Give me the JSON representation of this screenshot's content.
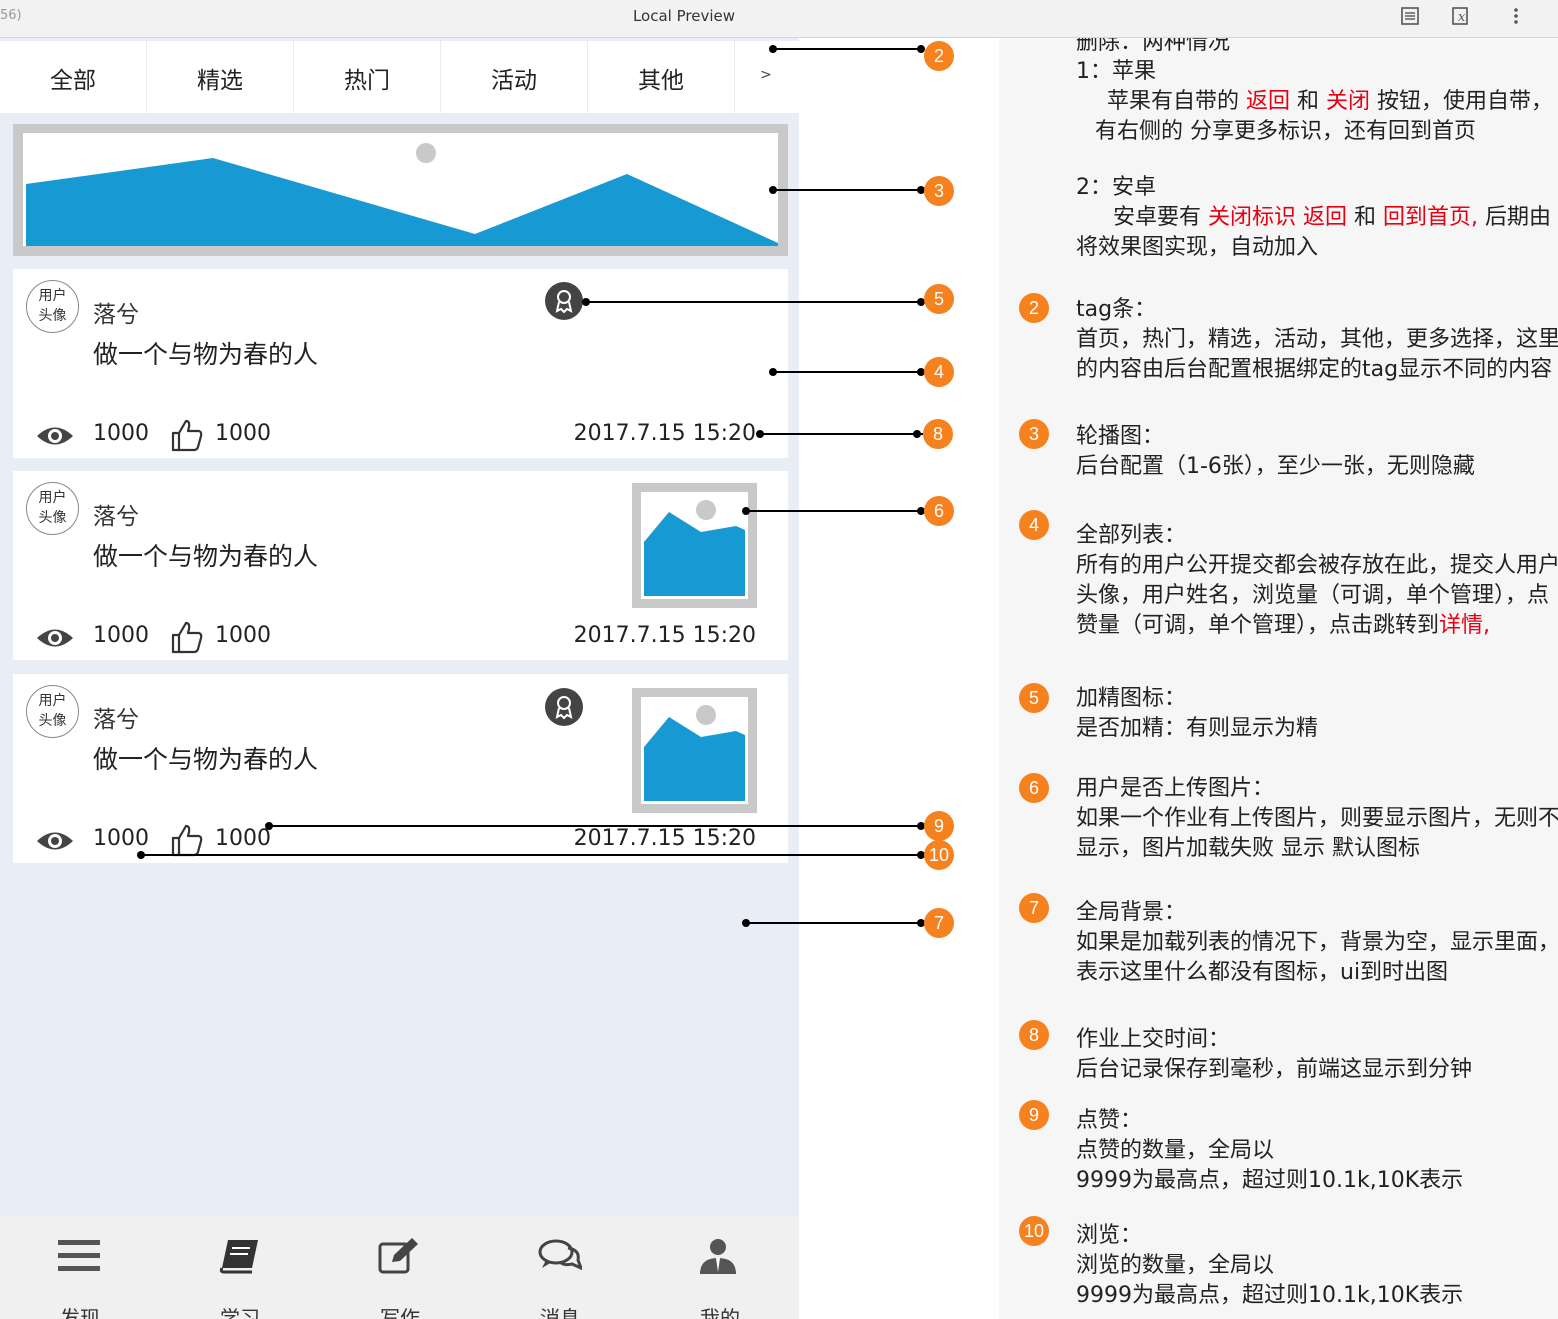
{
  "window": {
    "left_fragment": "56)",
    "title": "Local Preview",
    "icons": [
      "document-icon",
      "formula-icon",
      "more-vertical-icon"
    ]
  },
  "tabs": {
    "items": [
      "全部",
      "精选",
      "热门",
      "活动",
      "其他"
    ],
    "more": ">"
  },
  "cards": [
    {
      "avatar_line1": "用户",
      "avatar_line2": "头像",
      "name": "落兮",
      "text": "做一个与物为春的人",
      "views": "1000",
      "likes": "1000",
      "time": "2017.7.15 15:20",
      "badge": true,
      "image": false
    },
    {
      "avatar_line1": "用户",
      "avatar_line2": "头像",
      "name": "落兮",
      "text": "做一个与物为春的人",
      "views": "1000",
      "likes": "1000",
      "time": "2017.7.15 15:20",
      "badge": false,
      "image": true
    },
    {
      "avatar_line1": "用户",
      "avatar_line2": "头像",
      "name": "落兮",
      "text": "做一个与物为春的人",
      "views": "1000",
      "likes": "1000",
      "time": "2017.7.15 15:20",
      "badge": true,
      "image": true
    }
  ],
  "bottom_nav": [
    "发现",
    "学习",
    "写作",
    "消息",
    "我的"
  ],
  "markers": {
    "m2": "2",
    "m3": "3",
    "m5": "5",
    "m4": "4",
    "m8": "8",
    "m6": "6",
    "m9": "9",
    "m10": "10",
    "m7": "7"
  },
  "notes": {
    "top_cut": "删除：两种情况",
    "apple_title": "1：苹果",
    "apple_p1": "苹果有自带的 ",
    "apple_r1": "返回",
    "apple_p2": " 和 ",
    "apple_r2": "关闭",
    "apple_p3": " 按钮，使用自带，",
    "apple_line2": "有右侧的 分享更多标识，还有回到首页",
    "android_title": "2：安卓",
    "android_p1": "安卓要有 ",
    "android_r1": "关闭标识 返回",
    "android_p2": " 和 ",
    "android_r2": "回到首页,",
    "android_p3": " 后期由",
    "android_line2": "将效果图实现，自动加入",
    "items": [
      {
        "num": "2",
        "title": "tag条：",
        "lines": [
          "首页，热门，精选，活动，其他，更多选择，这里",
          "的内容由后台配置根据绑定的tag显示不同的内容"
        ]
      },
      {
        "num": "3",
        "title": "轮播图：",
        "lines": [
          "后台配置（1-6张），至少一张，无则隐藏"
        ]
      },
      {
        "num": "4",
        "title": "全部列表：",
        "lines": [
          "所有的用户公开提交都会被存放在此，提交人用户",
          "头像，用户姓名，浏览量（可调，单个管理），点"
        ],
        "line3a": "赞量（可调，单个管理），点击跳转到",
        "line3b": "详情,"
      },
      {
        "num": "5",
        "title": "加精图标：",
        "lines": [
          "是否加精：有则显示为精"
        ]
      },
      {
        "num": "6",
        "title": "用户是否上传图片：",
        "lines": [
          "如果一个作业有上传图片，则要显示图片，无则不",
          "显示，图片加载失败 显示 默认图标"
        ]
      },
      {
        "num": "7",
        "title": "全局背景：",
        "lines": [
          "如果是加载列表的情况下，背景为空，显示里面，",
          "表示这里什么都没有图标，ui到时出图"
        ]
      },
      {
        "num": "8",
        "title": "作业上交时间：",
        "lines": [
          "后台记录保存到毫秒，前端这显示到分钟"
        ]
      },
      {
        "num": "9",
        "title": "点赞：",
        "lines": [
          "点赞的数量，全局以",
          "9999为最高点，超过则10.1k,10K表示"
        ]
      },
      {
        "num": "10",
        "title": "浏览：",
        "lines": [
          "浏览的数量，全局以",
          "9999为最高点，超过则10.1k,10K表示"
        ]
      }
    ]
  },
  "colors": {
    "accent": "#f5811f",
    "chart_blue": "#1799d3",
    "page_bg": "#e8edf6",
    "red_text": "#e60012"
  }
}
